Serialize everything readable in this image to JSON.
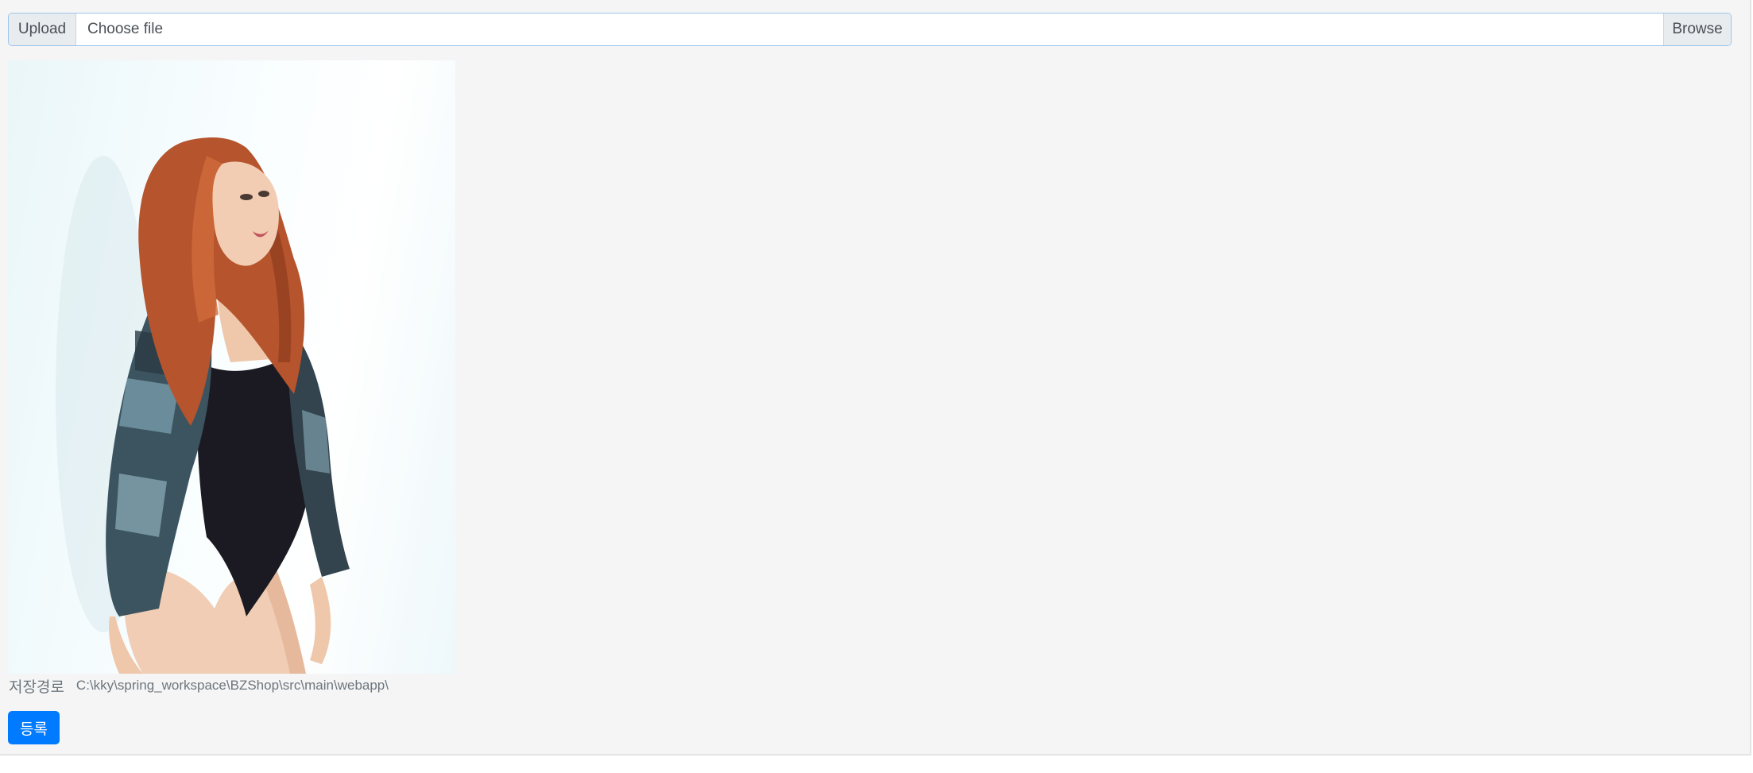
{
  "upload": {
    "addon_label": "Upload",
    "file_placeholder": "Choose file",
    "browse_label": "Browse"
  },
  "preview": {
    "image_icon": "photo-of-woman-red-hair-sequin-jacket"
  },
  "storage": {
    "label": "저장경로",
    "path": "C:\\kky\\spring_workspace\\BZShop\\src\\main\\webapp\\"
  },
  "actions": {
    "submit_label": "등록"
  },
  "colors": {
    "primary": "#007bff",
    "page_background": "#f5f5f5",
    "input_border": "#9cc4ec"
  }
}
